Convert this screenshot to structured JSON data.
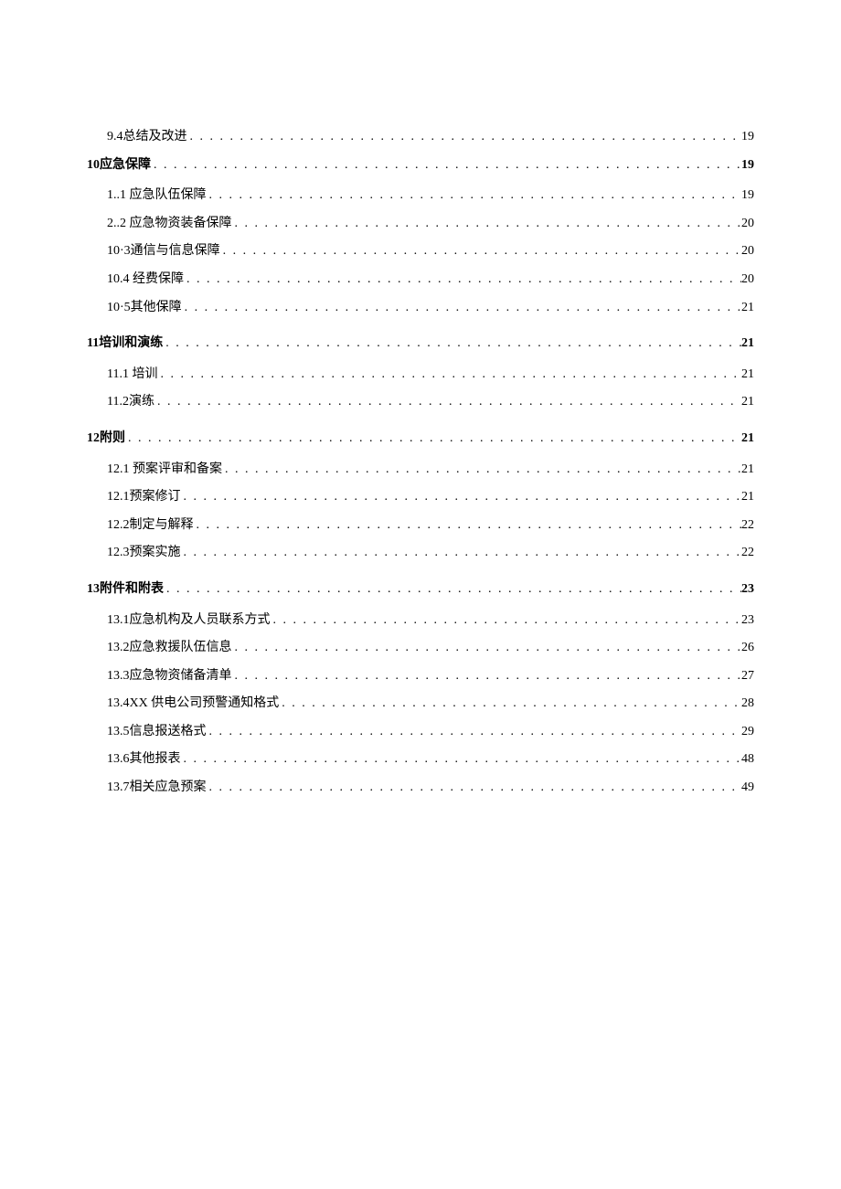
{
  "toc": [
    {
      "level": "sub",
      "num": "9.4",
      "title": "总结及改进",
      "page": "19"
    },
    {
      "level": "bold first",
      "num": "10",
      "title": "应急保障",
      "page": "19"
    },
    {
      "level": "sub",
      "num": "1.",
      "title": ".1 应急队伍保障",
      "page": "19"
    },
    {
      "level": "sub",
      "num": "2.",
      "title": ".2 应急物资装备保障",
      "page": "20"
    },
    {
      "level": "sub",
      "num": "10·3",
      "title": "通信与信息保障",
      "page": "20"
    },
    {
      "level": "sub",
      "num": "10.",
      "title": "4 经费保障",
      "page": "20"
    },
    {
      "level": "sub",
      "num": "10·5",
      "title": "其他保障",
      "page": "21"
    },
    {
      "level": "bold",
      "num": "11",
      "title": "培训和演练",
      "page": "21"
    },
    {
      "level": "sub",
      "num": "11.",
      "title": "1 培训",
      "page": "21"
    },
    {
      "level": "sub",
      "num": "11.2",
      "title": "演练",
      "page": "21"
    },
    {
      "level": "bold",
      "num": "12",
      "title": "附则",
      "page": "21"
    },
    {
      "level": "sub",
      "num": "12.",
      "title": "1 预案评审和备案",
      "page": "21"
    },
    {
      "level": "sub",
      "num": "12.1",
      "title": "预案修订",
      "page": "21"
    },
    {
      "level": "sub",
      "num": "12.2",
      "title": "制定与解释",
      "page": "22"
    },
    {
      "level": "sub",
      "num": "12.3",
      "title": "预案实施",
      "page": "22"
    },
    {
      "level": "bold",
      "num": "13",
      "title": "附件和附表",
      "page": "23"
    },
    {
      "level": "sub",
      "num": "13.1",
      "title": "应急机构及人员联系方式",
      "page": "23"
    },
    {
      "level": "sub",
      "num": "13.2",
      "title": "应急救援队伍信息",
      "page": "26"
    },
    {
      "level": "sub",
      "num": "13.3",
      "title": "应急物资储备清单",
      "page": "27"
    },
    {
      "level": "sub",
      "num": "13.4",
      "title": "XX 供电公司预警通知格式",
      "page": "28"
    },
    {
      "level": "sub",
      "num": "13.5",
      "title": "信息报送格式",
      "page": "29"
    },
    {
      "level": "sub",
      "num": "13.6",
      "title": "其他报表",
      "page": "48"
    },
    {
      "level": "sub",
      "num": "13.7",
      "title": "相关应急预案",
      "page": "49"
    }
  ]
}
